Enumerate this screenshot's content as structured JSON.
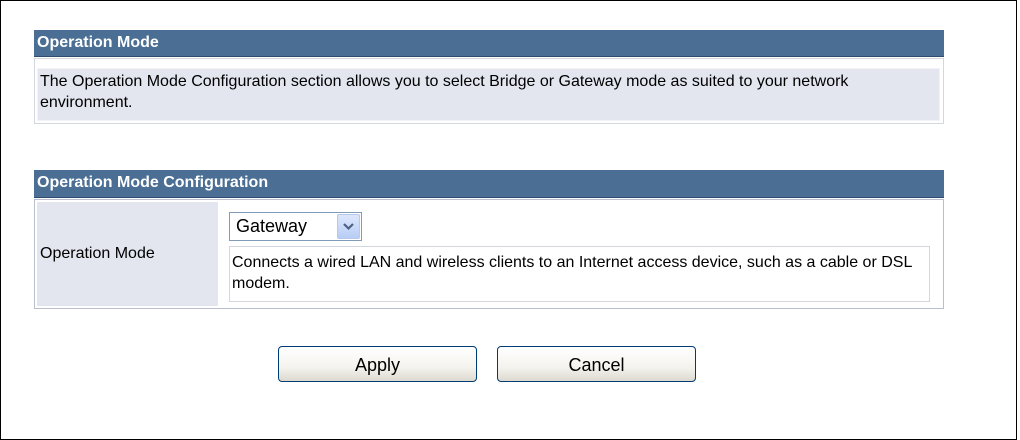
{
  "operation_mode_section": {
    "title": "Operation Mode",
    "description": "The Operation Mode Configuration section allows you to select Bridge or Gateway mode as suited to your network environment."
  },
  "configuration_section": {
    "title": "Operation Mode Configuration",
    "field_label": "Operation Mode",
    "selected_mode": "Gateway",
    "mode_description": "Connects a wired LAN and wireless clients to an Internet access device, such as a cable or DSL modem."
  },
  "buttons": {
    "apply": "Apply",
    "cancel": "Cancel"
  },
  "colors": {
    "header_background": "#4a6e94",
    "label_background": "#e3e6ef"
  },
  "icons": {
    "dropdown": "chevron-down-icon"
  }
}
